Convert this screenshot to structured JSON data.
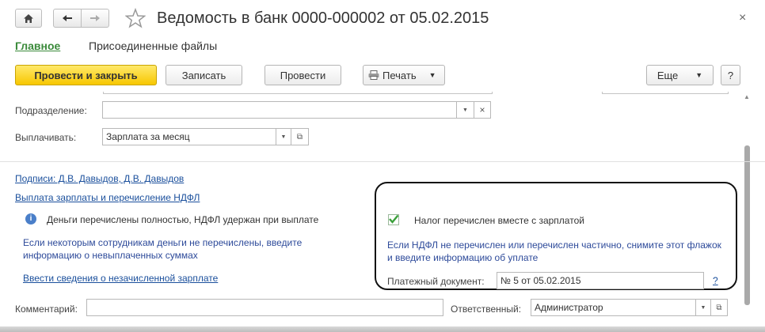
{
  "window": {
    "title": "Ведомость в банк 0000-000002 от 05.02.2015",
    "close_glyph": "×"
  },
  "tabs": [
    {
      "label": "Главное"
    },
    {
      "label": "Присоединенные файлы"
    }
  ],
  "toolbar": {
    "post_close": "Провести и закрыть",
    "save": "Записать",
    "post": "Провести",
    "print": "Печать",
    "more": "Еще",
    "help": "?"
  },
  "form": {
    "department_label": "Подразделение:",
    "department_value": "",
    "pay_label": "Выплачивать:",
    "pay_value": "Зарплата за месяц",
    "signatures_link": "Подписи: Д.В. Давыдов, Д.В. Давыдов",
    "payout_link": "Выплата зарплаты и перечисление НДФЛ",
    "status_text": "Деньги перечислены  полностью, НДФЛ удержан при выплате",
    "hint_unpaid": "Если некоторым сотрудникам деньги не перечислены, введите информацию о невыплаченных суммах",
    "unpaid_link": "Ввести сведения о незачисленной зарплате",
    "tax_checkbox_label": "Налог перечислен вместе с зарплатой",
    "tax_checkbox_checked": true,
    "tax_hint": "Если НДФЛ не перечислен или перечислен частично, снимите этот флажок и введите информацию об уплате",
    "payment_doc_label": "Платежный документ:",
    "payment_doc_value": "№ 5 от 05.02.2015",
    "payment_doc_help": "?",
    "comment_label": "Комментарий:",
    "comment_value": "",
    "responsible_label": "Ответственный:",
    "responsible_value": "Администратор"
  },
  "colors": {
    "primary_button": "#f7c700",
    "link": "#1a4f9c",
    "active_tab": "#3a8a3a",
    "checkbox": "#3aa03a"
  }
}
